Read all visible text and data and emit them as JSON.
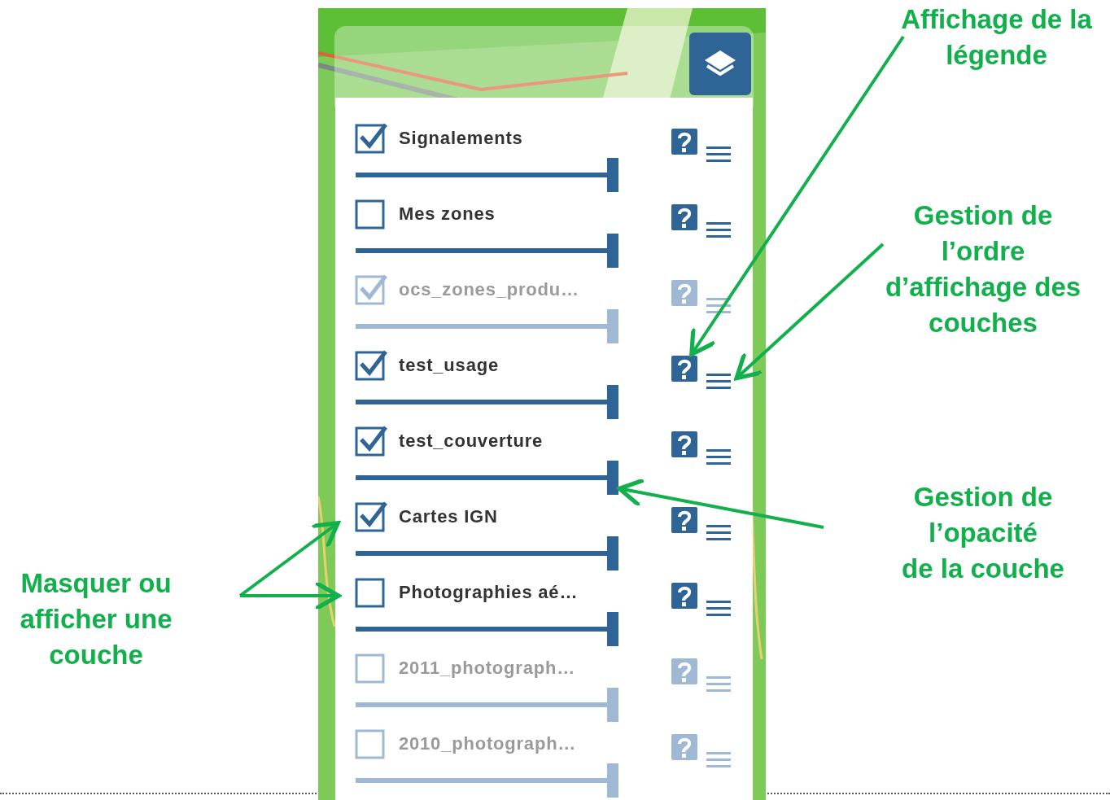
{
  "annotations": [
    {
      "text": "Affichage de la\nlégende"
    },
    {
      "text": "Gestion de\nl’ordre\nd’affichage des\ncouches"
    },
    {
      "text": "Gestion de\nl’opacité\nde la couche"
    },
    {
      "text": "Masquer ou\nafficher une\ncouche"
    }
  ],
  "layers": [
    {
      "name": "Signalements",
      "checked": true,
      "disabled": false,
      "level": 1
    },
    {
      "name": "Mes zones",
      "checked": false,
      "disabled": false,
      "level": 1
    },
    {
      "name": "ocs_zones_produ…",
      "checked": true,
      "disabled": true,
      "level": 1
    },
    {
      "name": "test_usage",
      "checked": true,
      "disabled": false,
      "level": 1
    },
    {
      "name": "test_couverture",
      "checked": true,
      "disabled": false,
      "level": 1
    },
    {
      "name": "Cartes IGN",
      "checked": true,
      "disabled": false,
      "level": 1
    },
    {
      "name": "Photographies aé…",
      "checked": false,
      "disabled": false,
      "level": 1
    },
    {
      "name": "2011_photograph…",
      "checked": false,
      "disabled": true,
      "level": 1
    },
    {
      "name": "2010_photograph…",
      "checked": false,
      "disabled": true,
      "level": 1
    }
  ]
}
